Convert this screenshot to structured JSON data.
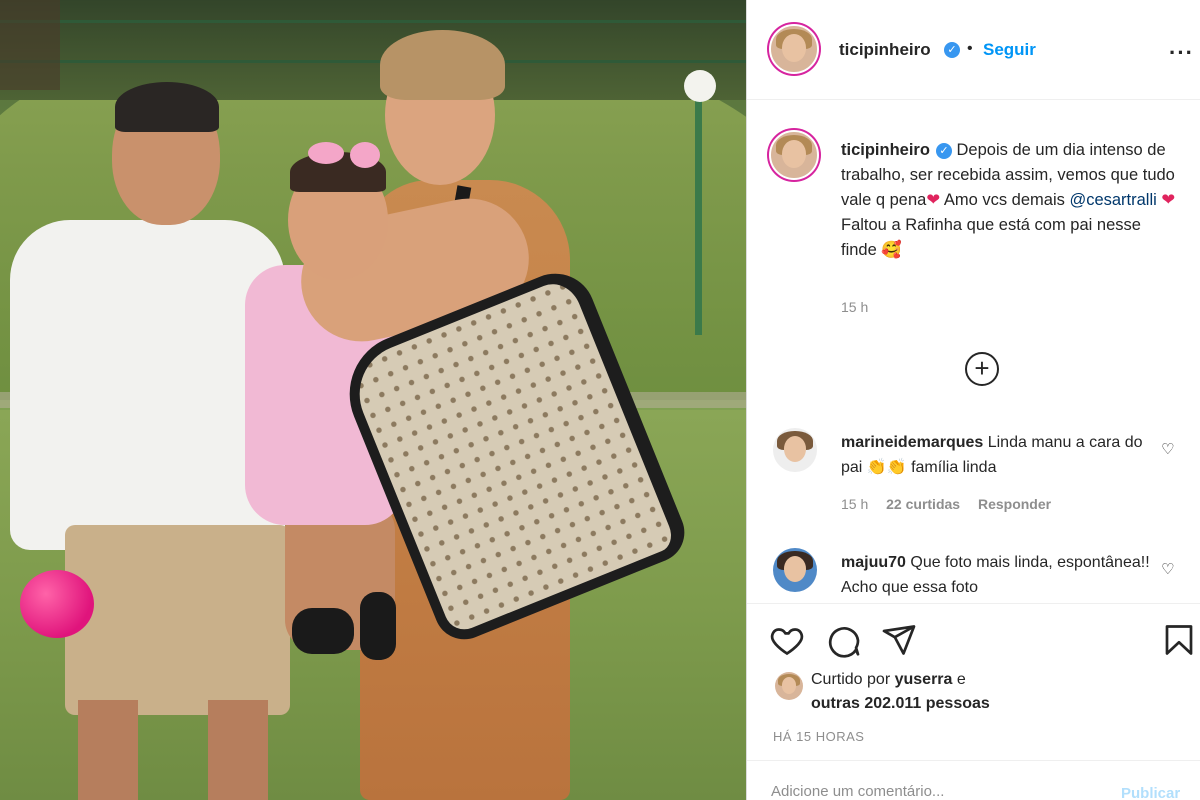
{
  "post": {
    "username": "ticipinheiro",
    "follow_label": "Seguir",
    "separator": "•",
    "more_label": "···"
  },
  "caption": {
    "username": "ticipinheiro",
    "text_1": " Depois de um dia intenso de trabalho, ser recebida assim, vemos que tudo vale q pena",
    "heart_1": "❤",
    "text_2": " Amo vcs demais ",
    "mention": "@cesartralli",
    "heart_2": "❤",
    "text_3": " Faltou a Rafinha que está com pai nesse finde ",
    "emoji_3": "🥰",
    "time": "15 h"
  },
  "load_more_label": "+",
  "comments": [
    {
      "username": "marineidemarques",
      "text": " Linda manu a cara do pai 👏👏 família linda",
      "time": "15 h",
      "likes": "22 curtidas",
      "reply": "Responder"
    },
    {
      "username": "majuu70",
      "text": " Que foto mais linda, espontânea!! Acho que essa foto"
    }
  ],
  "likes": {
    "prefix": "Curtido por ",
    "user": "yuserra",
    "suffix": " e",
    "others": "outras 202.011 pessoas"
  },
  "post_age": "HÁ 15 HORAS",
  "comment_box": {
    "placeholder": "Adicione um comentário...",
    "publish_label": "Publicar"
  },
  "colors": {
    "accent": "#0095f6",
    "verified": "#3897f0",
    "border": "#dbdbdb",
    "muted": "#8e8e8e",
    "text": "#262626"
  }
}
